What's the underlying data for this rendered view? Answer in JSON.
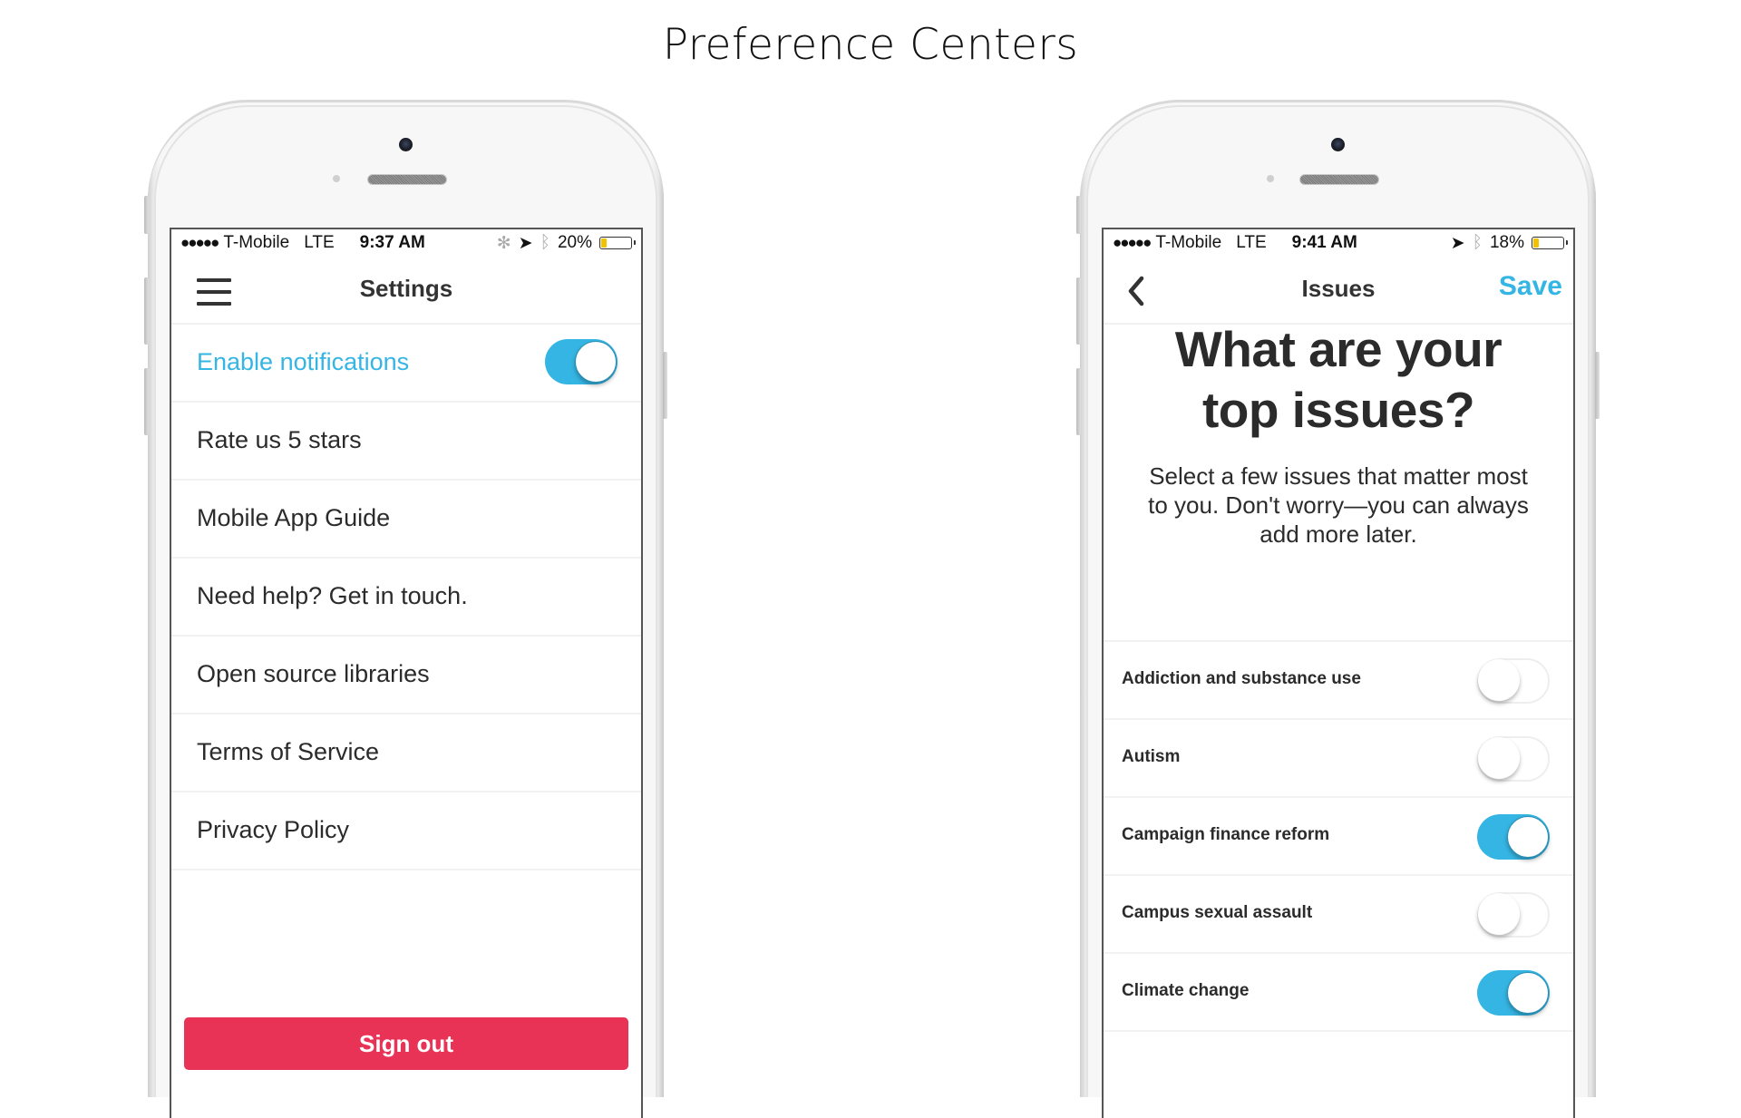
{
  "page": {
    "title": "Preference Centers"
  },
  "colors": {
    "accent": "#35b5e3",
    "danger": "#e83256",
    "text": "#2b2b2b"
  },
  "left_phone": {
    "status": {
      "signal": "●●●●●",
      "carrier": "T-Mobile",
      "network": "LTE",
      "time": "9:37 AM",
      "activity_icon": "spinner-icon",
      "location_icon": "location-arrow-icon",
      "bluetooth_icon": "bluetooth-icon",
      "battery": "20%",
      "battery_level": 0.2
    },
    "nav": {
      "menu_icon": "hamburger-icon",
      "title": "Settings"
    },
    "rows": [
      {
        "label": "Enable notifications",
        "toggle": true
      },
      {
        "label": "Rate us 5 stars"
      },
      {
        "label": "Mobile App Guide"
      },
      {
        "label": "Need help? Get in touch."
      },
      {
        "label": "Open source libraries"
      },
      {
        "label": "Terms of Service"
      },
      {
        "label": "Privacy Policy"
      }
    ],
    "sign_out": "Sign out"
  },
  "right_phone": {
    "status": {
      "signal": "●●●●●",
      "carrier": "T-Mobile",
      "network": "LTE",
      "time": "9:41 AM",
      "location_icon": "location-arrow-icon",
      "bluetooth_icon": "bluetooth-icon",
      "battery": "18%",
      "battery_level": 0.18
    },
    "nav": {
      "back_icon": "chevron-left-icon",
      "title": "Issues",
      "save": "Save"
    },
    "headline_line1": "What are your",
    "headline_line2": "top issues?",
    "subtitle_line1": "Select a few issues that matter most",
    "subtitle_line2": "to you. Don't worry—you can always",
    "subtitle_line3": "add more later.",
    "issues": [
      {
        "label": "Addiction and substance use",
        "on": false
      },
      {
        "label": "Autism",
        "on": false
      },
      {
        "label": "Campaign finance reform",
        "on": true
      },
      {
        "label": "Campus sexual assault",
        "on": false
      },
      {
        "label": "Climate change",
        "on": true
      }
    ]
  }
}
